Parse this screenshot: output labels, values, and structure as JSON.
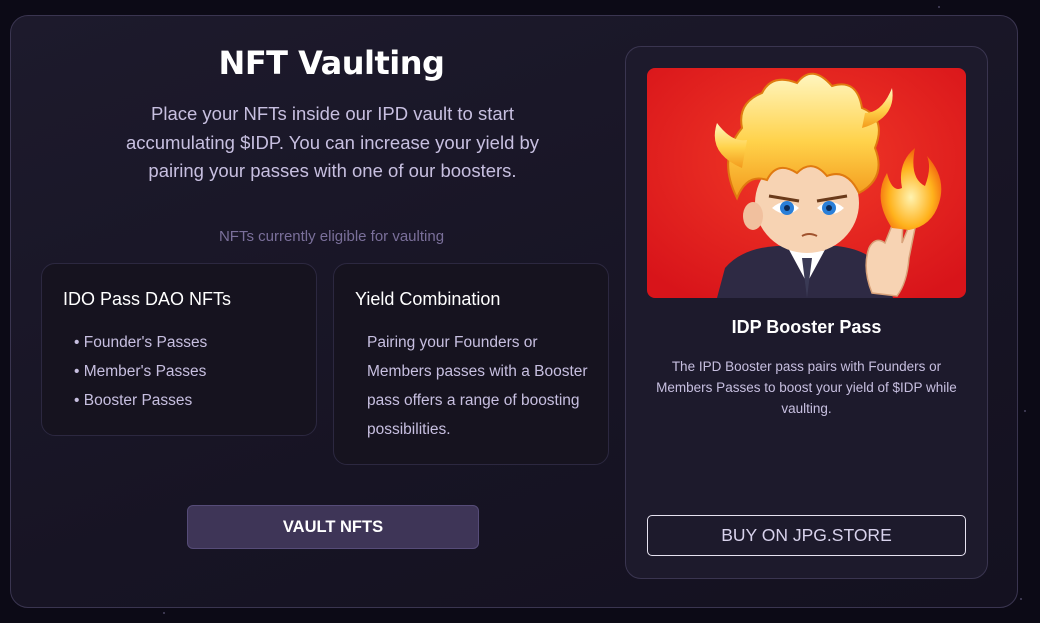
{
  "header": {
    "title": "NFT Vaulting",
    "intro": "Place your NFTs inside our IPD vault to start accumulating $IDP. You can increase your yield by pairing your passes with one of our boosters.",
    "eligible_label": "NFTs currently eligible for vaulting"
  },
  "cards": {
    "ido_pass": {
      "title": "IDO Pass DAO NFTs",
      "items": [
        "Founder's Passes",
        "Member's Passes",
        "Booster Passes"
      ]
    },
    "yield": {
      "title": "Yield Combination",
      "text": "Pairing your Founders or Members passes with a Booster pass offers a range of boosting possibilities."
    }
  },
  "actions": {
    "vault_label": "VAULT NFTS"
  },
  "booster": {
    "name": "IDP Booster Pass",
    "description": "The IPD Booster pass pairs with Founders or Members Passes to boost your yield of $IDP while vaulting.",
    "buy_label": "BUY ON JPG.STORE",
    "image_icon": "flame-hair-character-icon"
  },
  "colors": {
    "background": "#0c0a16",
    "panel": "#1a1728",
    "accent_button": "#3e3557",
    "text_muted": "#c7bfe0",
    "image_bg": "#e8201e"
  }
}
